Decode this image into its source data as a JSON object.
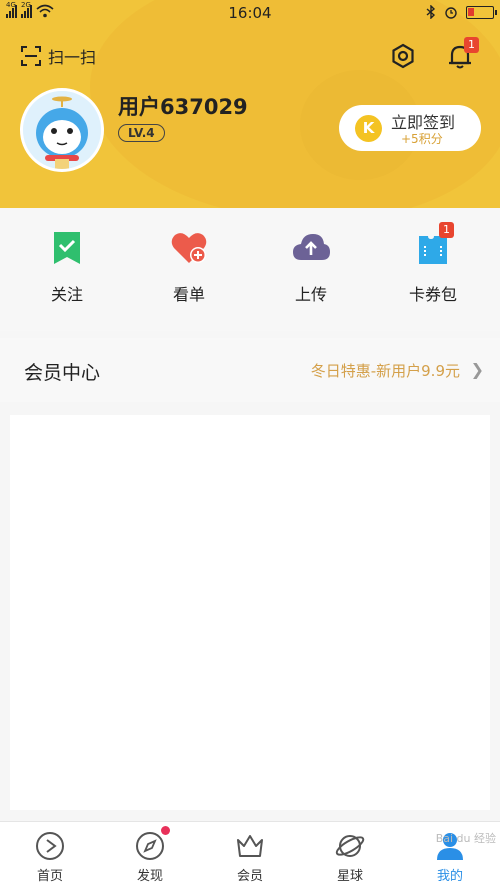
{
  "status_bar": {
    "signal1": "4G",
    "signal2": "2G",
    "time": "16:04"
  },
  "header": {
    "scan_label": "扫一扫",
    "notification_badge": "1",
    "username": "用户637029",
    "level": "LV.4",
    "checkin": {
      "coin_letter": "K",
      "label": "立即签到",
      "reward": "+5积分"
    }
  },
  "actions": [
    {
      "label": "关注",
      "icon": "follow-icon"
    },
    {
      "label": "看单",
      "icon": "watchlist-icon"
    },
    {
      "label": "上传",
      "icon": "upload-icon"
    },
    {
      "label": "卡券包",
      "icon": "coupon-icon",
      "badge": "1"
    }
  ],
  "vip": {
    "title": "会员中心",
    "promo": "冬日特惠-新用户9.9元"
  },
  "tabbar": [
    {
      "label": "首页",
      "icon": "home-play-icon"
    },
    {
      "label": "发现",
      "icon": "compass-icon"
    },
    {
      "label": "会员",
      "icon": "crown-icon"
    },
    {
      "label": "星球",
      "icon": "planet-icon"
    },
    {
      "label": "我的",
      "icon": "profile-icon",
      "active": true
    }
  ],
  "watermark": "Bai du 经验",
  "colors": {
    "header_bg": "#f1c43a",
    "accent_gold": "#d4a04a",
    "badge_red": "#e8452f",
    "active_blue": "#2a8fe6"
  }
}
